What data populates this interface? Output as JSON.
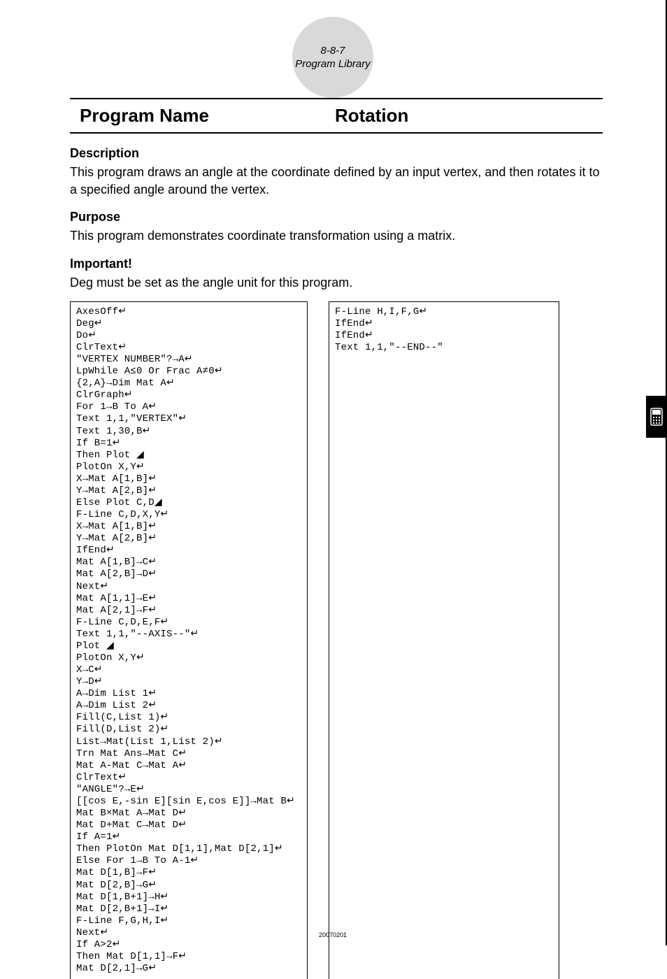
{
  "header": {
    "section_num": "8-8-7",
    "section_name": "Program Library"
  },
  "title": {
    "label": "Program Name",
    "value": "Rotation"
  },
  "description": {
    "heading": "Description",
    "text": "This program draws an angle at the coordinate defined by an input vertex, and then rotates it to a specified angle around the vertex."
  },
  "purpose": {
    "heading": "Purpose",
    "text": "This program demonstrates coordinate transformation using a matrix."
  },
  "important": {
    "heading": "Important!",
    "text": "Deg must be set as the angle unit for this program."
  },
  "code": {
    "left": "AxesOff↵\nDeg↵\nDo↵\nClrText↵\n\"VERTEX NUMBER\"?→A↵\nLpWhile A≤0 Or Frac A≠0↵\n{2,A}→Dim Mat A↵\nClrGraph↵\nFor 1→B To A↵\nText 1,1,\"VERTEX\"↵\nText 1,30,B↵\nIf B=1↵\nThen Plot ◢\nPlotOn X,Y↵\nX→Mat A[1,B]↵\nY→Mat A[2,B]↵\nElse Plot C,D◢\nF-Line C,D,X,Y↵\nX→Mat A[1,B]↵\nY→Mat A[2,B]↵\nIfEnd↵\nMat A[1,B]→C↵\nMat A[2,B]→D↵\nNext↵\nMat A[1,1]→E↵\nMat A[2,1]→F↵\nF-Line C,D,E,F↵\nText 1,1,\"--AXIS--\"↵\nPlot ◢\nPlotOn X,Y↵\nX→C↵\nY→D↵\nA→Dim List 1↵\nA→Dim List 2↵\nFill(C,List 1)↵\nFill(D,List 2)↵\nList→Mat(List 1,List 2)↵\nTrn Mat Ans→Mat C↵\nMat A-Mat C→Mat A↵\nClrText↵\n\"ANGLE\"?→E↵\n[[cos E,-sin E][sin E,cos E]]→Mat B↵\nMat B×Mat A→Mat D↵\nMat D+Mat C→Mat D↵\nIf A=1↵\nThen PlotOn Mat D[1,1],Mat D[2,1]↵\nElse For 1→B To A-1↵\nMat D[1,B]→F↵\nMat D[2,B]→G↵\nMat D[1,B+1]→H↵\nMat D[2,B+1]→I↵\nF-Line F,G,H,I↵\nNext↵\nIf A>2↵\nThen Mat D[1,1]→F↵\nMat D[2,1]→G↵",
    "right": "F-Line H,I,F,G↵\nIfEnd↵\nIfEnd↵\nText 1,1,\"--END--\""
  },
  "footer": {
    "num": "20070201"
  }
}
